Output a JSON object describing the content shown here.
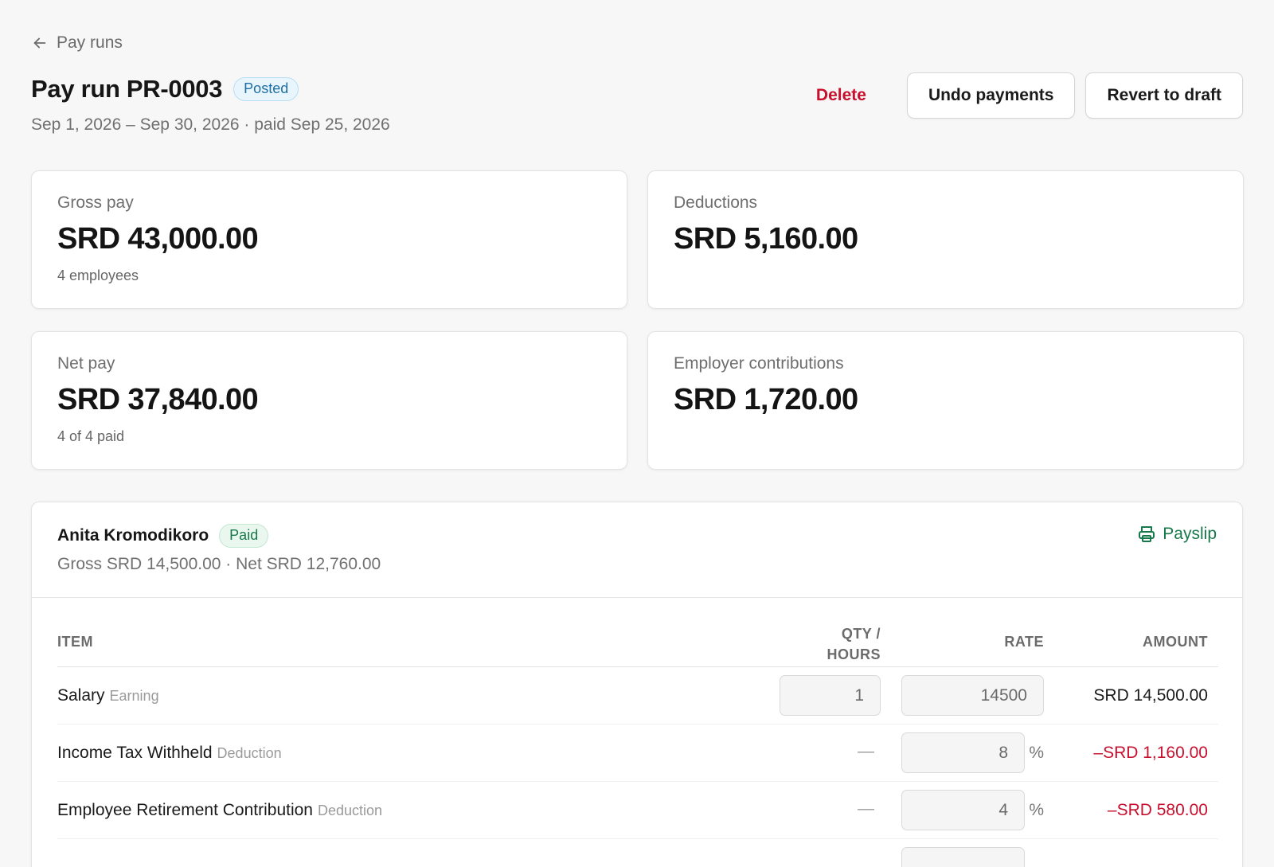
{
  "nav": {
    "back_label": "Pay runs"
  },
  "header": {
    "title": "Pay run PR-0003",
    "status": "Posted",
    "subtitle": "Sep 1, 2026 – Sep 30, 2026 · paid Sep 25, 2026",
    "actions": {
      "delete": "Delete",
      "undo": "Undo payments",
      "revert": "Revert to draft"
    }
  },
  "summary": {
    "gross": {
      "label": "Gross pay",
      "value": "SRD 43,000.00",
      "note": "4 employees"
    },
    "deductions": {
      "label": "Deductions",
      "value": "SRD 5,160.00"
    },
    "net": {
      "label": "Net pay",
      "value": "SRD 37,840.00",
      "note": "4 of 4 paid"
    },
    "employer": {
      "label": "Employer contributions",
      "value": "SRD 1,720.00"
    }
  },
  "employee": {
    "name": "Anita Kromodikoro",
    "status": "Paid",
    "subtitle": "Gross SRD 14,500.00 · Net SRD 12,760.00",
    "payslip_label": "Payslip",
    "columns": {
      "item": "Item",
      "qty_line1": "Qty /",
      "qty_line2": "Hours",
      "rate": "Rate",
      "amount": "Amount"
    },
    "rows": [
      {
        "item": "Salary",
        "type": "Earning",
        "qty": "1",
        "rate": "14500",
        "amount": "SRD 14,500.00"
      },
      {
        "item": "Income Tax Withheld",
        "type": "Deduction",
        "qty": "—",
        "rate": "8",
        "rate_unit": "%",
        "amount": "–SRD 1,160.00"
      },
      {
        "item": "Employee Retirement Contribution",
        "type": "Deduction",
        "qty": "—",
        "rate": "4",
        "rate_unit": "%",
        "amount": "–SRD 580.00"
      }
    ]
  },
  "colors": {
    "accent_green": "#17794a",
    "danger_red": "#c8102e",
    "posted_blue": "#1f6fa3"
  },
  "icons": {
    "back": "arrow-left-icon",
    "payslip": "printer-icon"
  }
}
